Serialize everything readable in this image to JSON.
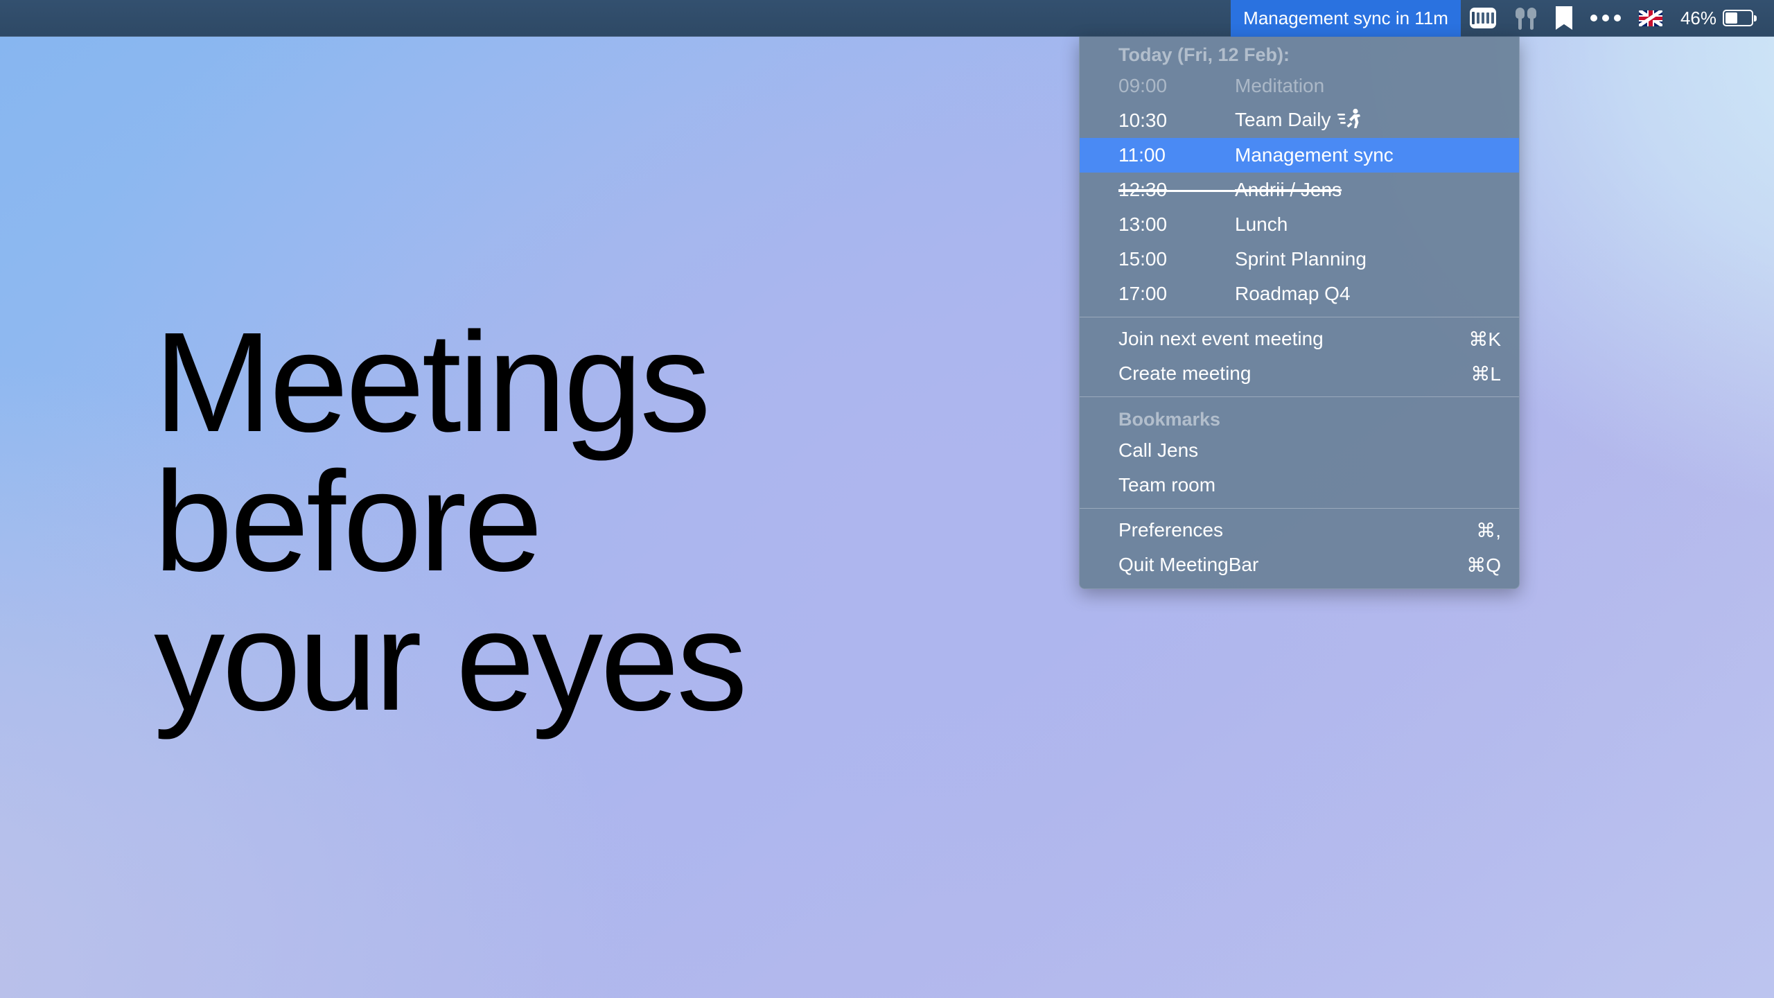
{
  "desktop": {
    "headline": "Meetings\nbefore\nyour eyes"
  },
  "menubar": {
    "title": "Management sync in 11m",
    "battery_percent": "46%",
    "icons": [
      {
        "name": "audio-equalizer-icon"
      },
      {
        "name": "airpods-icon"
      },
      {
        "name": "bookmark-icon"
      },
      {
        "name": "more-dots-icon"
      },
      {
        "name": "uk-flag-icon"
      },
      {
        "name": "battery-icon"
      }
    ],
    "accent_color": "#2a72e0",
    "bar_color": "#2f4a68"
  },
  "menu": {
    "today_header": "Today (Fri, 12 Feb):",
    "events": [
      {
        "time": "09:00",
        "title": "Meditation",
        "state": "past"
      },
      {
        "time": "10:30",
        "title": "Team Daily",
        "state": "normal",
        "badge": "running-person-icon"
      },
      {
        "time": "11:00",
        "title": "Management sync",
        "state": "selected"
      },
      {
        "time": "12:30",
        "title": "Andrii / Jens",
        "state": "declined"
      },
      {
        "time": "13:00",
        "title": "Lunch",
        "state": "normal"
      },
      {
        "time": "15:00",
        "title": "Sprint Planning",
        "state": "normal"
      },
      {
        "time": "17:00",
        "title": "Roadmap Q4",
        "state": "normal"
      }
    ],
    "actions": [
      {
        "label": "Join next event meeting",
        "shortcut": "⌘K"
      },
      {
        "label": "Create meeting",
        "shortcut": "⌘L"
      }
    ],
    "bookmarks_header": "Bookmarks",
    "bookmarks": [
      {
        "label": "Call Jens",
        "shortcut": ""
      },
      {
        "label": "Team room",
        "shortcut": ""
      }
    ],
    "footer": [
      {
        "label": "Preferences",
        "shortcut": "⌘,"
      },
      {
        "label": "Quit MeetingBar",
        "shortcut": "⌘Q"
      }
    ],
    "selected_color": "#4a8af4",
    "panel_color": "#6a8199"
  }
}
